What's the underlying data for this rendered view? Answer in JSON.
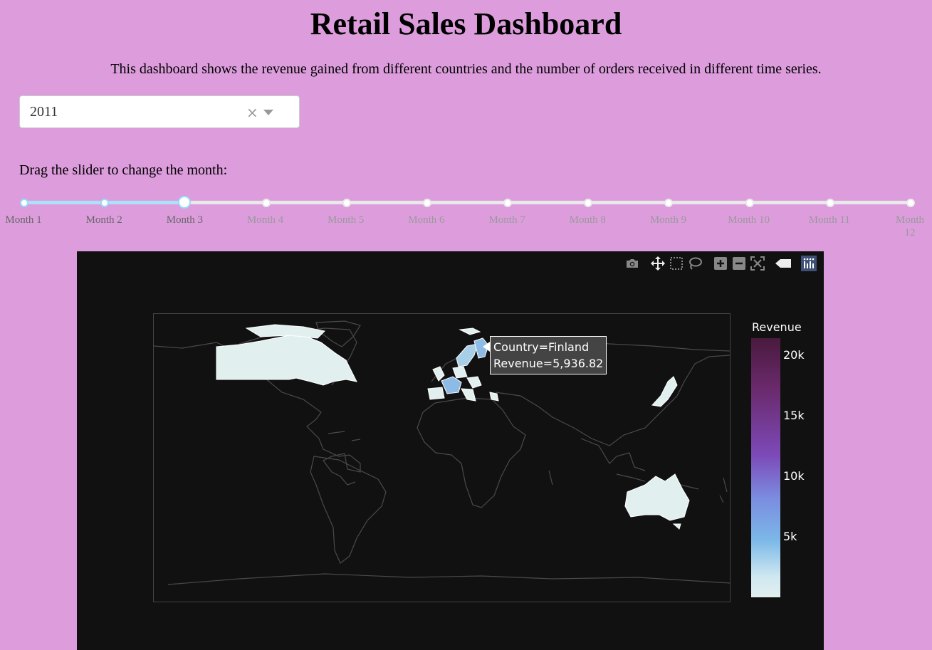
{
  "header": {
    "title": "Retail Sales Dashboard",
    "description": "This dashboard shows the revenue gained from different countries and the number of orders received in different time series."
  },
  "year_dropdown": {
    "value": "2011",
    "clear_symbol": "×"
  },
  "slider": {
    "label": "Drag the slider to change the month:",
    "marks": [
      "Month 1",
      "Month 2",
      "Month 3",
      "Month 4",
      "Month 5",
      "Month 6",
      "Month 7",
      "Month 8",
      "Month 9",
      "Month 10",
      "Month 11",
      "Month 12"
    ],
    "selected_index": 2,
    "track_color": "#abe2fb",
    "rail_color": "#e9e9e9"
  },
  "map": {
    "background": "#111111",
    "colorbar": {
      "title": "Revenue",
      "ticks": [
        "20k",
        "15k",
        "10k",
        "5k"
      ]
    },
    "tooltip": {
      "line1": "Country=Finland",
      "line2": "Revenue=5,936.82"
    },
    "modebar_icons": [
      "camera-icon",
      "pan-icon",
      "box-select-icon",
      "lasso-icon",
      "zoom-in-icon",
      "zoom-out-icon",
      "autoscale-icon",
      "reset-icon",
      "plotly-logo-icon"
    ]
  },
  "colors": {
    "page_background": "#dd9ddd",
    "country_fill": "#e2efef",
    "finland_fill": "#8cbbe6"
  }
}
